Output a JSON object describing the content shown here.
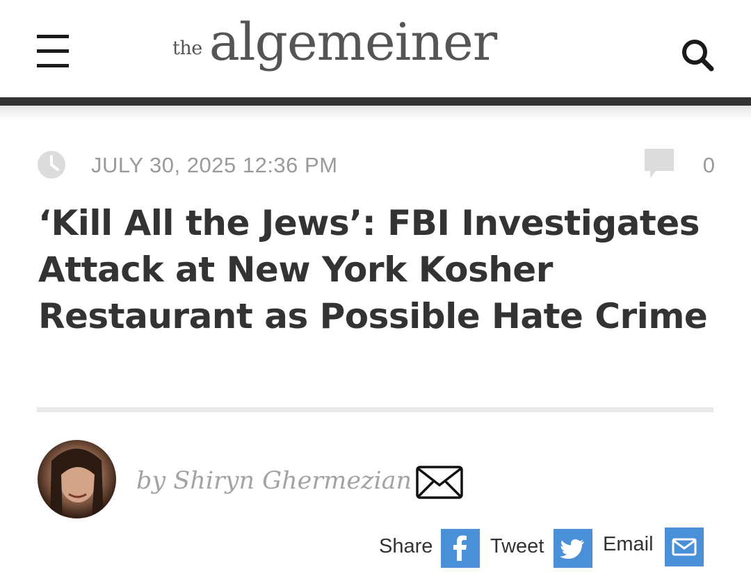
{
  "header": {
    "logo_prefix": "the",
    "logo_name": "algemeiner",
    "menu_icon": "hamburger-menu-icon",
    "search_icon": "search-icon"
  },
  "article": {
    "date": "JULY 30, 2025 12:36 PM",
    "comment_count": "0",
    "headline": "‘Kill All the Jews’: FBI Investigates Attack at New York Kosher Restaurant as Possible Hate Crime",
    "byline": "by Shiryn Ghermezian"
  },
  "share": {
    "share_label": "Share",
    "tweet_label": "Tweet",
    "email_label": "Email"
  },
  "colors": {
    "header_bar": "#333333",
    "meta_gray": "#9a9a9a",
    "headline": "#333333",
    "share_blue": "#4a90d9"
  }
}
